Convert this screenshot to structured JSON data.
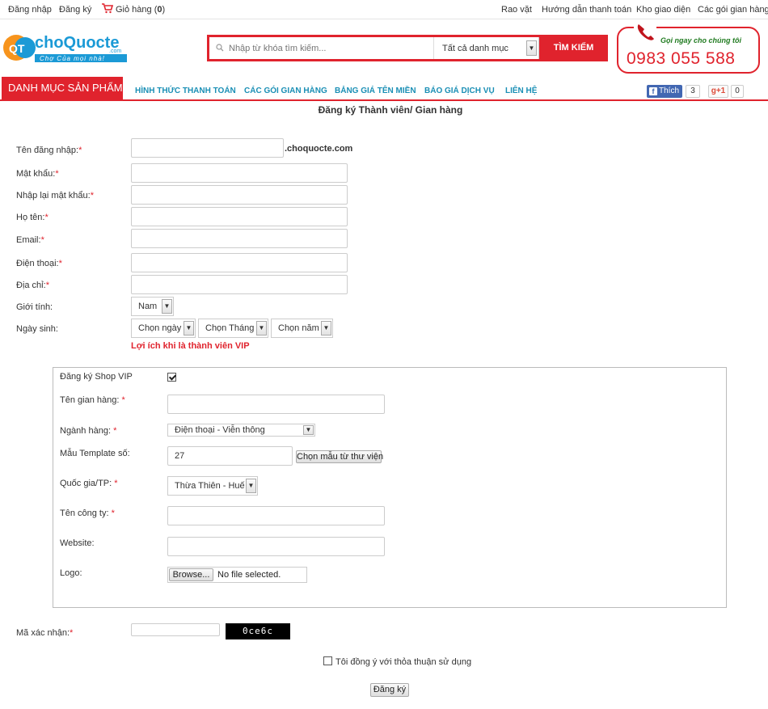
{
  "topbar": {
    "login": "Đăng nhập",
    "register": "Đăng ký",
    "cart_label": "Giỏ hàng (",
    "cart_count": "0",
    "cart_close": ")",
    "links": [
      "Rao vặt",
      "Hướng dẫn thanh toán",
      "Kho giao diện",
      "Các gói gian hàng"
    ]
  },
  "logo": {
    "initials": "QT",
    "name": "choQuocte",
    "tld": ".com",
    "tagline": "Chợ Của mọi nhà!"
  },
  "search": {
    "placeholder": "Nhập từ khóa tìm kiếm...",
    "category": "Tất cả danh mục",
    "button": "TÌM KIẾM"
  },
  "hotline": {
    "call_text": "Gọi ngay cho chúng tôi",
    "number": "0983 055 588"
  },
  "nav": {
    "category_button": "DANH MỤC SẢN PHẨM",
    "items": [
      "HÌNH THỨC THANH TOÁN",
      "CÁC GÓI GIAN HÀNG",
      "BẢNG GIÁ TÊN MIỀN",
      "BÁO GIÁ DỊCH VỤ",
      "LIÊN HỆ"
    ],
    "fb_like": "Thích",
    "fb_count": "3",
    "gplus": "+1",
    "gplus_count": "0"
  },
  "page_title": "Đăng ký Thành viên/ Gian hàng",
  "form": {
    "username_label": "Tên đăng nhập:",
    "domain_suffix": ".choquocte.com",
    "password_label": "Mật khẩu:",
    "confirm_label": "Nhập lại mật khẩu:",
    "fullname_label": "Họ tên:",
    "email_label": "Email:",
    "phone_label": "Điện thoại:",
    "address_label": "Địa chỉ:",
    "gender_label": "Giới tính:",
    "gender_value": "Nam",
    "dob_label": "Ngày sinh:",
    "dob_day": "Chọn ngày",
    "dob_month": "Chọn Tháng",
    "dob_year": "Chọn năm",
    "vip_link": "Lợi ích khi là thành viên VIP",
    "required_mark": "*"
  },
  "vip": {
    "shop_vip_label": "Đăng ký Shop VIP",
    "shop_name_label": "Tên gian hàng:",
    "industry_label": "Ngành hàng:",
    "industry_value": "Điện thoại - Viễn thông",
    "template_label": "Mẫu Template số:",
    "template_value": "27",
    "template_button": "Chọn mẫu từ thư viện",
    "province_label": "Quốc gia/TP:",
    "province_value": "Thừa Thiên - Huế",
    "company_label": "Tên công ty:",
    "website_label": "Website:",
    "logo_label": "Logo:",
    "browse_button": "Browse...",
    "no_file": "No file selected."
  },
  "captcha": {
    "label": "Mã xác nhận:",
    "code": "0ce6c"
  },
  "agree_label": "Tôi đồng ý với thỏa thuận sử dụng",
  "submit_button": "Đăng ký",
  "colors": {
    "brand_red": "#e0232d",
    "nav_blue": "#1a8fb5"
  }
}
